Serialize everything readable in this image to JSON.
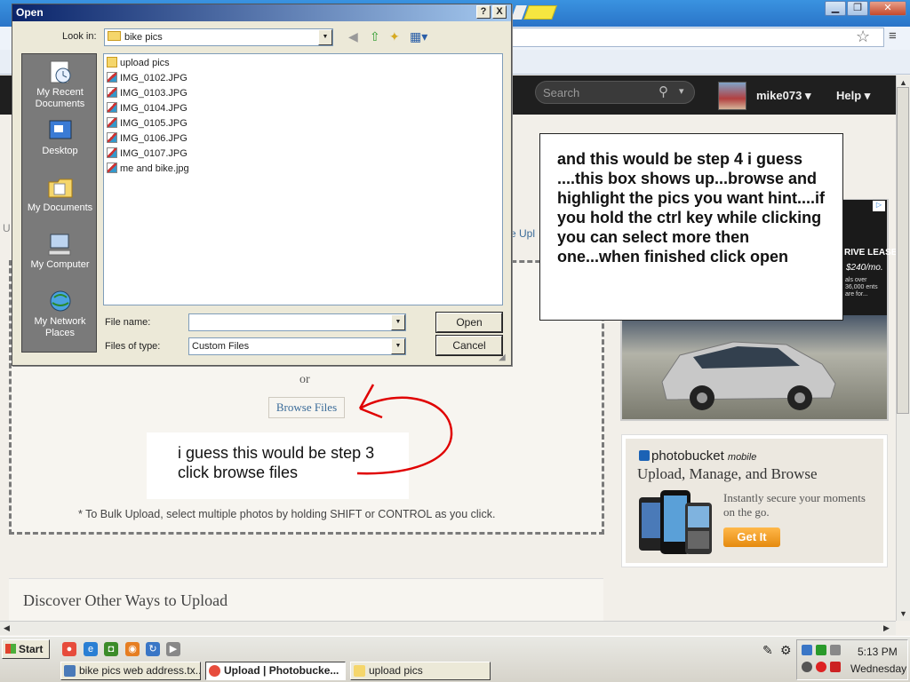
{
  "dialog": {
    "title": "Open",
    "help_btn": "?",
    "close_btn": "X",
    "lookin_label": "Look in:",
    "lookin_value": "bike pics",
    "places": [
      "My Recent Documents",
      "Desktop",
      "My Documents",
      "My Computer",
      "My Network Places"
    ],
    "files": [
      {
        "name": "upload pics",
        "kind": "folder"
      },
      {
        "name": "IMG_0102.JPG",
        "kind": "jpg"
      },
      {
        "name": "IMG_0103.JPG",
        "kind": "jpg"
      },
      {
        "name": "IMG_0104.JPG",
        "kind": "jpg"
      },
      {
        "name": "IMG_0105.JPG",
        "kind": "jpg"
      },
      {
        "name": "IMG_0106.JPG",
        "kind": "jpg"
      },
      {
        "name": "IMG_0107.JPG",
        "kind": "jpg"
      },
      {
        "name": "me and bike.jpg",
        "kind": "jpg"
      }
    ],
    "filename_label": "File name:",
    "filename_value": "",
    "filetype_label": "Files of type:",
    "filetype_value": "Custom Files",
    "open_btn": "Open",
    "cancel_btn": "Cancel"
  },
  "header": {
    "search_placeholder": "Search",
    "username": "mike073",
    "help": "Help"
  },
  "upload": {
    "or": "or",
    "browse_button": "Browse Files",
    "bulk_hint": "* To Bulk Upload, select multiple photos by holding SHIFT or CONTROL as you click.",
    "link_fragment": "e Upl",
    "left_fragment": "U",
    "discover_title": "Discover Other Ways to Upload"
  },
  "notes": {
    "step3": "i guess this would be step 3 click browse files",
    "step4": "and this would be step 4 i guess ....this box shows up...browse and highlight the pics you want hint....if you hold the ctrl key while           clicking you can select more then one...when finished click open"
  },
  "ads": {
    "car_lease": "RIVE LEASE",
    "car_price": "$240/mo.",
    "car_fine": "als over 36,000 ents are for...",
    "mobile_logo": "photobucket",
    "mobile_logo_suffix": "mobile",
    "mobile_headline": "Upload, Manage, and Browse",
    "mobile_text": "Instantly secure your moments on the go.",
    "mobile_button": "Get It"
  },
  "taskbar": {
    "start": "Start",
    "tasks": [
      {
        "label": "bike pics web address.tx...",
        "active": false
      },
      {
        "label": "Upload | Photobucke...",
        "active": true
      },
      {
        "label": "upload pics",
        "active": false
      }
    ],
    "time": "5:13 PM",
    "day": "Wednesday"
  },
  "colors": {
    "xp_title_start": "#0a246a",
    "annotation_red": "#e00000",
    "pb_header": "#1f1f1f",
    "get_it_orange": "#f0a020"
  }
}
